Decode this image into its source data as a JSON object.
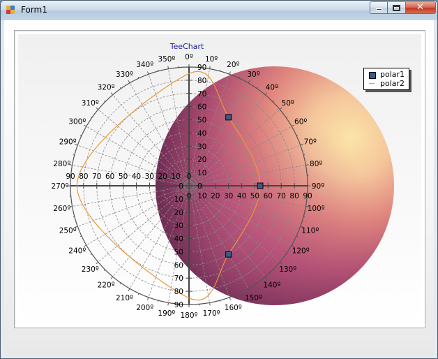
{
  "window": {
    "title": "Form1",
    "controls": {
      "minimize": "minimize",
      "maximize": "maximize",
      "close": "close"
    }
  },
  "colors": {
    "accent_orange": "#e89a3a",
    "polar1_fill": "#3b5a8a",
    "title_color": "#1a1aa0"
  },
  "chart_data": {
    "type": "polar",
    "title": "TeeChart",
    "radius_ticks": [
      0,
      10,
      20,
      30,
      40,
      50,
      60,
      70,
      80,
      90
    ],
    "angle_labels": [
      "0º",
      "10º",
      "20º",
      "30º",
      "40º",
      "50º",
      "60º",
      "70º",
      "80º",
      "90º",
      "100º",
      "110º",
      "120º",
      "130º",
      "140º",
      "150º",
      "160º",
      "170º",
      "180º",
      "190º",
      "200º",
      "210º",
      "220º",
      "230º",
      "240º",
      "250º",
      "260º",
      "270º",
      "280º",
      "290º",
      "300º",
      "310º",
      "320º",
      "330º",
      "340º",
      "350º"
    ],
    "grid": true,
    "legend_position": "top-right",
    "series": [
      {
        "name": "polar1",
        "points": [
          {
            "angle": 30,
            "radius": 60
          },
          {
            "angle": 90,
            "radius": 54
          },
          {
            "angle": 150,
            "radius": 60
          }
        ],
        "style": "square-markers"
      },
      {
        "name": "polar2",
        "points": [
          {
            "angle": 0,
            "radius": 85
          },
          {
            "angle": 30,
            "radius": 60
          },
          {
            "angle": 90,
            "radius": 54
          },
          {
            "angle": 150,
            "radius": 60
          },
          {
            "angle": 180,
            "radius": 85
          },
          {
            "angle": 270,
            "radius": 85
          }
        ],
        "style": "line"
      }
    ]
  }
}
